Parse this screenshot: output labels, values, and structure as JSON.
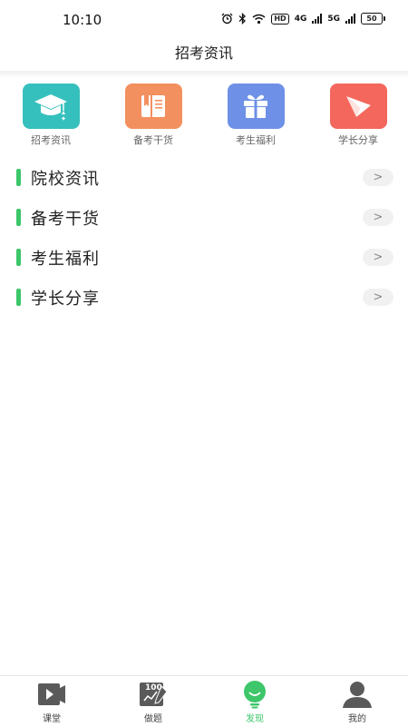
{
  "status_bar": {
    "time": "10:10",
    "signal1": "4G",
    "signal2": "5G",
    "hd": "HD",
    "battery": "50"
  },
  "header": {
    "title": "招考资讯"
  },
  "quick": [
    {
      "label": "招考资讯",
      "icon": "graduation-cap-icon",
      "color": "#36c0bd"
    },
    {
      "label": "备考干货",
      "icon": "book-icon",
      "color": "#f3905f"
    },
    {
      "label": "考生福利",
      "icon": "gift-icon",
      "color": "#6e90e6"
    },
    {
      "label": "学长分享",
      "icon": "paper-plane-icon",
      "color": "#f4675c"
    }
  ],
  "list": [
    {
      "label": "院校资讯",
      "arrow": ">"
    },
    {
      "label": "备考干货",
      "arrow": ">"
    },
    {
      "label": "考生福利",
      "arrow": ">"
    },
    {
      "label": "学长分享",
      "arrow": ">"
    }
  ],
  "bottom_nav": [
    {
      "label": "课堂",
      "icon": "video-play-icon"
    },
    {
      "label": "做题",
      "icon": "exercise-score-icon",
      "badge": "100"
    },
    {
      "label": "发现",
      "icon": "lightbulb-icon",
      "active": true
    },
    {
      "label": "我的",
      "icon": "user-icon"
    }
  ],
  "colors": {
    "accent": "#3dc66a",
    "inactive_icon": "#5a5a5a"
  }
}
